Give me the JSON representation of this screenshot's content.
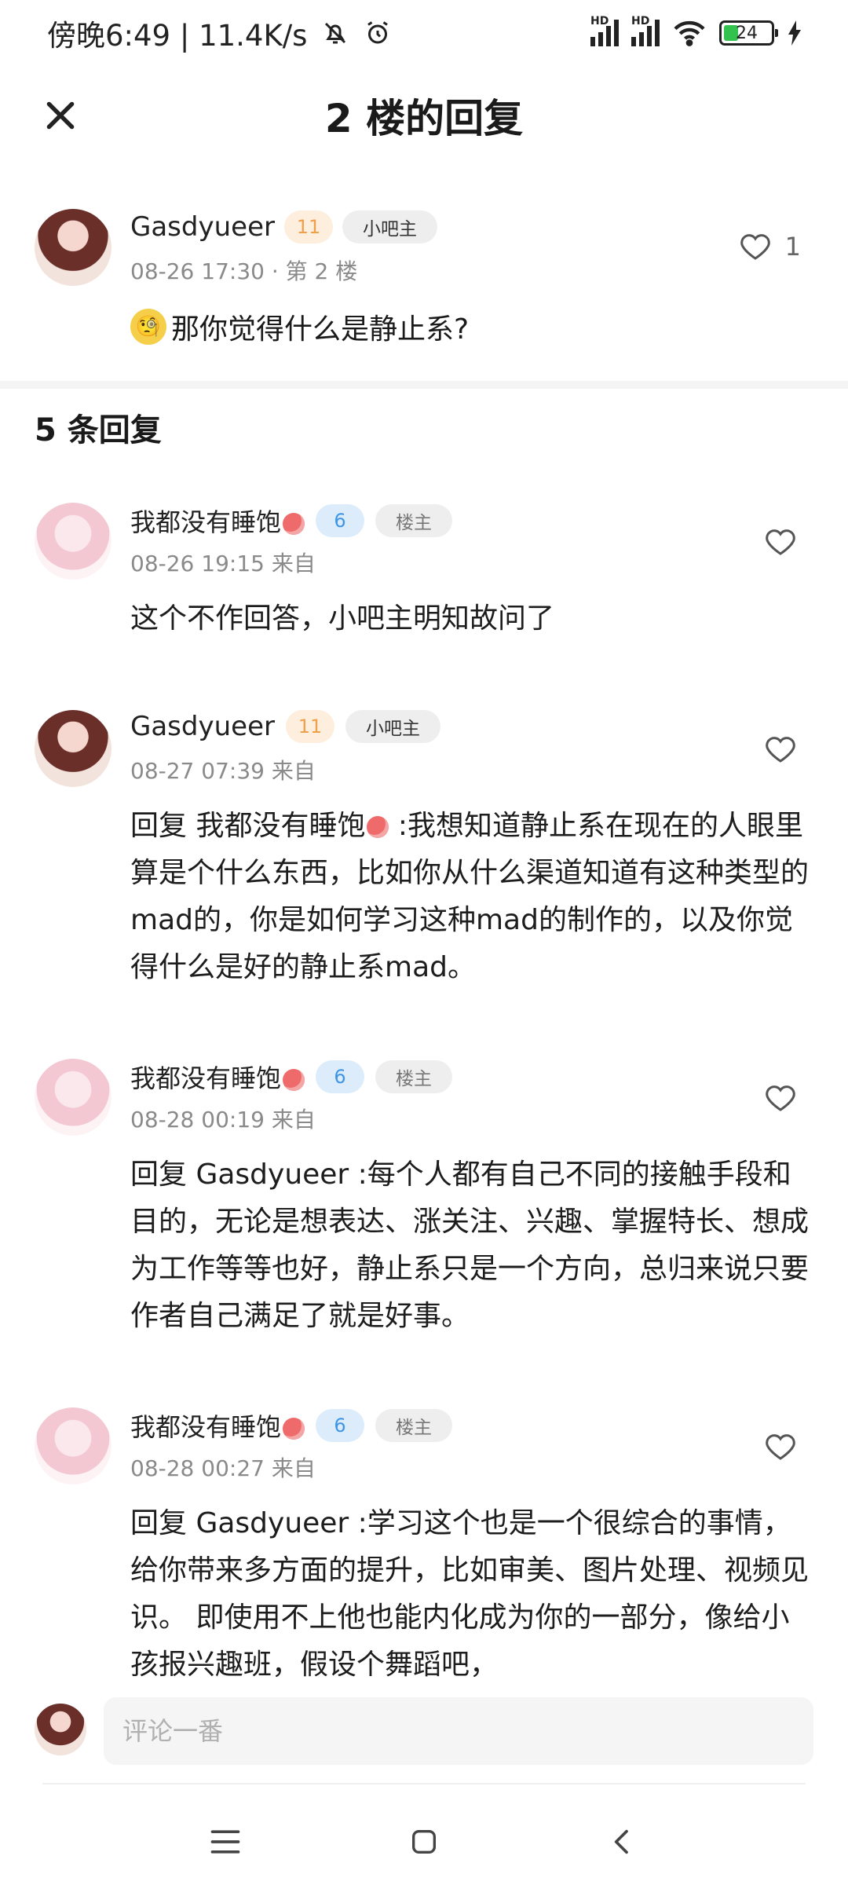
{
  "status_bar": {
    "time_text": "傍晚6:49 | 11.4K/s",
    "hd_label": "HD",
    "battery_level": "24"
  },
  "header": {
    "title": "2 楼的回复"
  },
  "main_post": {
    "username": "Gasdyueer",
    "level": "11",
    "role": "小吧主",
    "meta": "08-26 17:30 · 第 2 楼",
    "text": "那你觉得什么是静止系?",
    "like_count": "1"
  },
  "reply_count_label": "5 条回复",
  "replies": [
    {
      "username": "我都没有睡饱",
      "level": "6",
      "role": "楼主",
      "meta": "08-26 19:15 来自",
      "text": "这个不作回答，小吧主明知故问了"
    },
    {
      "username": "Gasdyueer",
      "level": "11",
      "role": "小吧主",
      "meta": "08-27 07:39 来自",
      "text_prefix": "回复 我都没有睡饱",
      "text": " :我想知道静止系在现在的人眼里算是个什么东西，比如你从什么渠道知道有这种类型的mad的，你是如何学习这种mad的制作的，以及你觉得什么是好的静止系mad。"
    },
    {
      "username": "我都没有睡饱",
      "level": "6",
      "role": "楼主",
      "meta": "08-28 00:19 来自",
      "text": "回复 Gasdyueer :每个人都有自己不同的接触手段和目的，无论是想表达、涨关注、兴趣、掌握特长、想成为工作等等也好，静止系只是一个方向，总归来说只要作者自己满足了就是好事。"
    },
    {
      "username": "我都没有睡饱",
      "level": "6",
      "role": "楼主",
      "meta": "08-28 00:27 来自",
      "text": "回复 Gasdyueer :学习这个也是一个很综合的事情，给你带来多方面的提升，比如审美、图片处理、视频见识。 即使用不上他也能内化成为你的一部分，像给小孩报兴趣班，假设个舞蹈吧，"
    }
  ],
  "comment_bar": {
    "placeholder": "评论一番"
  },
  "colors": {
    "level_orange": "#f0a04b",
    "level_blue": "#3e95e5",
    "battery_green": "#32c24d"
  }
}
